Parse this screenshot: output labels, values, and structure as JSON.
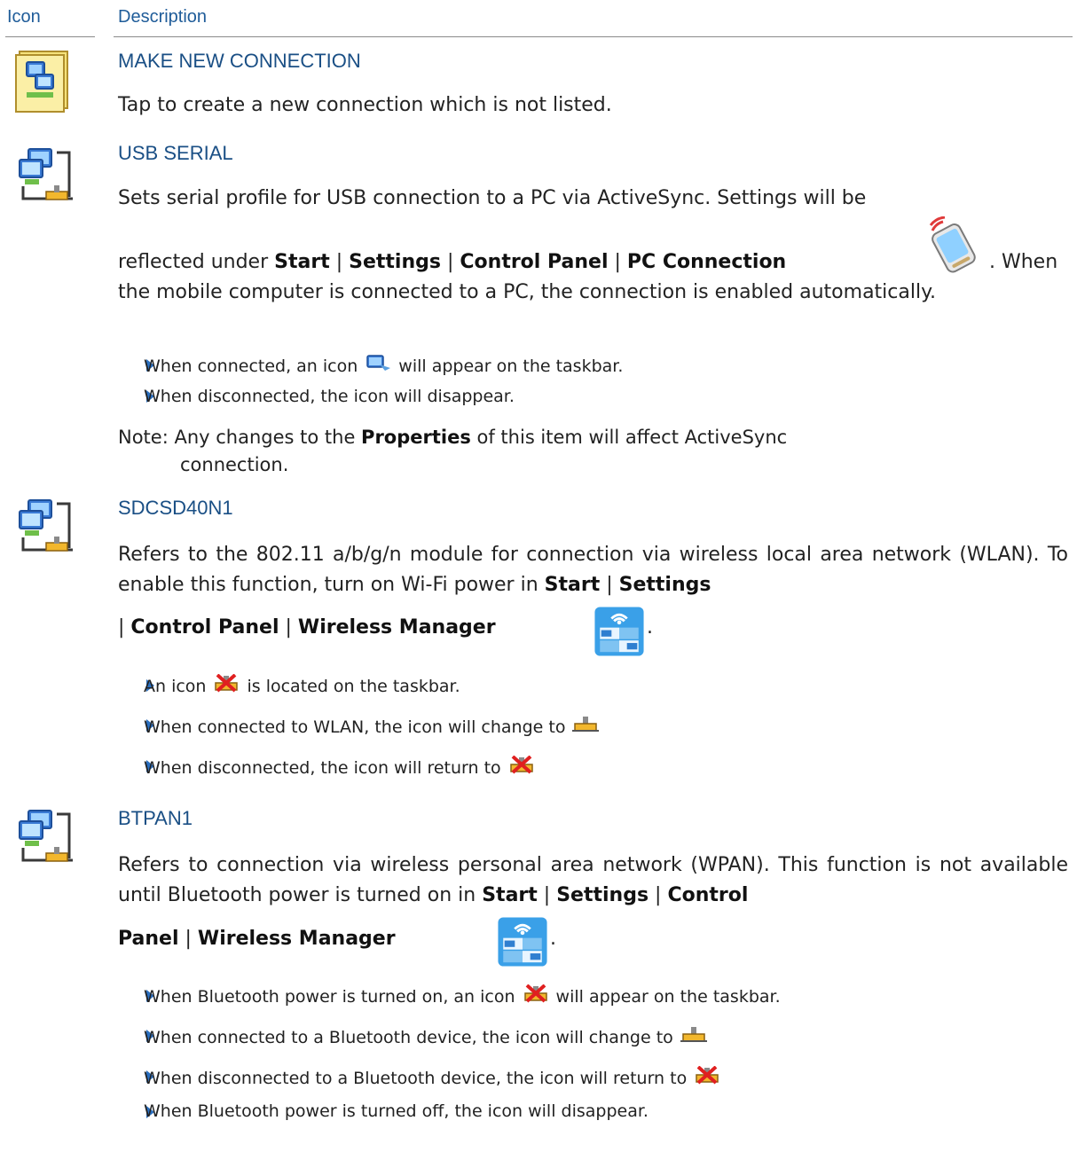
{
  "header": {
    "col_icon": "Icon",
    "col_description": "Description"
  },
  "icons": {
    "new_connection": "network-wizard-icon",
    "connection": "network-connection-icon",
    "pc_connection": "pc-connection-icon",
    "wireless_manager": "wireless-manager-icon",
    "taskbar_connected": "taskbar-connected-icon",
    "taskbar_disconnected": "taskbar-disconnected-icon",
    "taskbar_sync": "taskbar-sync-icon"
  },
  "sections": {
    "make_new": {
      "title": "MAKE NEW CONNECTION",
      "desc": "Tap to create a new connection which is not listed."
    },
    "usb": {
      "title": "USB SERIAL",
      "line1": "Sets serial profile for USB connection to a PC via ActiveSync. Settings will be",
      "l2_a": "reflected under ",
      "l2_start": "Start",
      "sep": " | ",
      "l2_settings": "Settings",
      "l2_control": "Control Panel",
      "l2_pc": "PC Connection",
      "l2_when": ". When",
      "line3": "the mobile computer is connected to a PC, the connection is enabled automatically.",
      "b1_pre": "When connected, an icon",
      "b1_post": "will appear on the taskbar.",
      "b2": "When disconnected, the icon will disappear.",
      "note_a": "Note: Any changes to the ",
      "note_bold": "Properties",
      "note_b": " of this item will affect ActiveSync",
      "note_c": "connection."
    },
    "sdcsd": {
      "title": "SDCSD40N1",
      "p_a": "Refers to the 802.11 a/b/g/n module for connection via wireless local area network (WLAN). To enable this function, turn on Wi-Fi power in ",
      "p_start": "Start",
      "p_settings": "Settings",
      "l3_control": "Control Panel",
      "l3_wm": "Wireless Manager",
      "period": ".",
      "b1_pre": "An icon",
      "b1_post": "is located on the taskbar.",
      "b2": "When connected to WLAN, the icon will change to",
      "b3": "When disconnected, the icon will return to"
    },
    "btpan": {
      "title": "BTPAN1",
      "p_a": "Refers to connection via wireless personal area network (WPAN). This function is not available until Bluetooth power is turned on in ",
      "p_start": "Start",
      "p_settings": "Settings",
      "p_control": "Control",
      "l3_panel": "Panel",
      "l3_wm": "Wireless Manager",
      "period": ".",
      "b1_pre": "When Bluetooth power is turned on, an icon",
      "b1_post": "will appear on the taskbar.",
      "b2": "When connected to a Bluetooth device, the icon will change to",
      "b3": "When disconnected to a Bluetooth device, the icon will return to",
      "b4": "When Bluetooth power is turned off, the icon will disappear."
    }
  }
}
